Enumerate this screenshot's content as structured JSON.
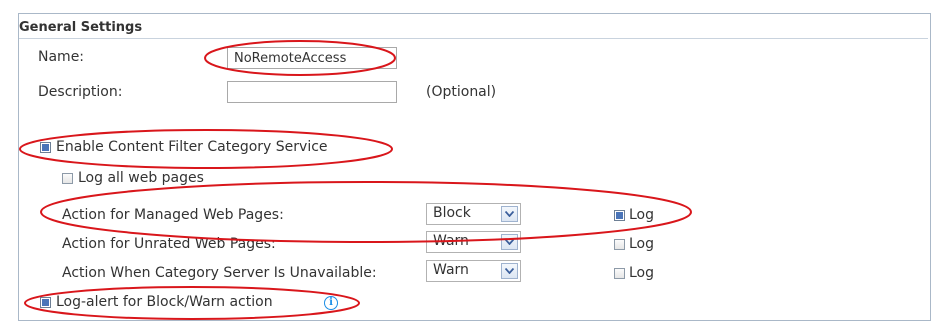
{
  "general": {
    "title": "General Settings",
    "name_label": "Name:",
    "name_value": "NoRemoteAccess",
    "description_label": "Description:",
    "description_value": "",
    "optional_hint": "(Optional)"
  },
  "content_filter": {
    "enable_label": "Enable Content Filter Category Service",
    "enable_checked": true,
    "log_all_label": "Log all web pages",
    "log_all_checked": false,
    "rows": [
      {
        "label": "Action for Managed Web Pages:",
        "action": "Block",
        "log_label": "Log",
        "log_checked": true
      },
      {
        "label": "Action for Unrated Web Pages:",
        "action": "Warn",
        "log_label": "Log",
        "log_checked": false
      },
      {
        "label": "Action When Category Server Is Unavailable:",
        "action": "Warn",
        "log_label": "Log",
        "log_checked": false
      }
    ],
    "log_alert_label": "Log-alert for Block/Warn action",
    "log_alert_checked": true
  },
  "colors": {
    "annotation_ellipse": "#d9161b",
    "checkbox_fill": "#4a74b8",
    "info_icon": "#1a8de6"
  },
  "icons": {
    "info": "info-circle-icon",
    "dropdown": "chevron-down-icon"
  }
}
